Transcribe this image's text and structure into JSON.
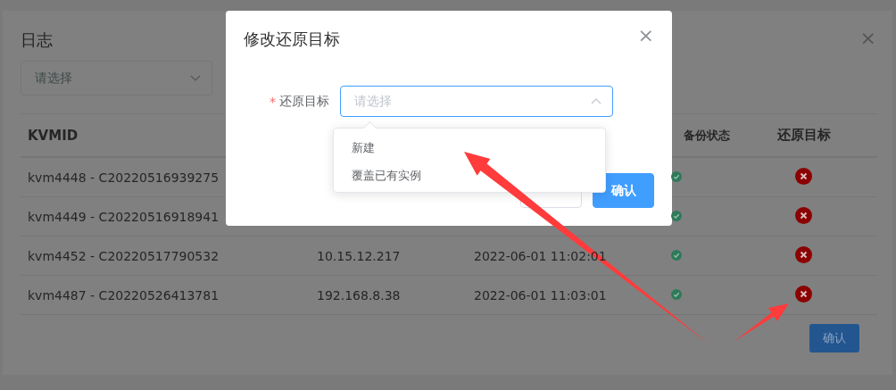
{
  "log_dialog": {
    "title": "日志",
    "close": "×",
    "filter": {
      "placeholder": "请选择"
    },
    "columns": {
      "kvmid": "KVMID",
      "backup_status": "备份状态",
      "restore_target": "还原目标"
    },
    "rows": [
      {
        "kvmid": "kvm4448 - C20220516939275",
        "backup_ok": true,
        "restore_ok": false
      },
      {
        "kvmid": "kvm4449 - C20220516918941",
        "backup_ok": true,
        "restore_ok": false
      },
      {
        "kvmid": "kvm4452 - C20220517790532",
        "column_2": "10.15.12.217",
        "column_3": "2022-06-01 11:02:01",
        "backup_ok": true,
        "restore_ok": false
      },
      {
        "kvmid": "kvm4487 - C20220526413781",
        "column_2": "192.168.8.38",
        "column_3": "2022-06-01 11:03:01",
        "backup_ok": true,
        "restore_ok": false
      }
    ],
    "confirm_label": "确认"
  },
  "modal": {
    "title": "修改还原目标",
    "close": "×",
    "field": {
      "required_mark": "*",
      "label": "还原目标",
      "placeholder": "请选择",
      "expanded": true,
      "options": [
        {
          "label": "新建",
          "selected": false
        },
        {
          "label": "覆盖已有实例",
          "selected": false
        }
      ]
    },
    "buttons": [
      {
        "kind": "secondary"
      },
      {
        "kind": "primary",
        "label": "确认"
      }
    ]
  }
}
